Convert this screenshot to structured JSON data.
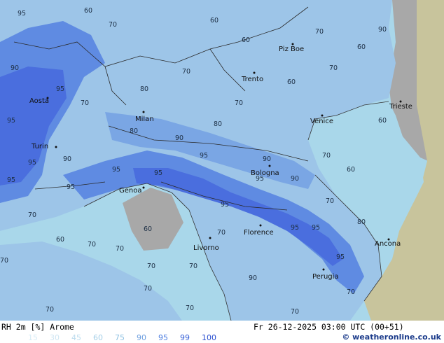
{
  "footer": {
    "variable": "RH 2m [%] Arome",
    "datetime": "Fr 26-12-2025 03:00 UTC (00+51)",
    "credit": "© weatheronline.co.uk"
  },
  "legend": {
    "values": [
      "15",
      "30",
      "45",
      "60",
      "75",
      "90",
      "95",
      "99",
      "100"
    ],
    "colors": [
      "#d8ecf6",
      "#cfe6f3",
      "#bcdcee",
      "#a5cfe8",
      "#8fc1e2",
      "#6e9fe0",
      "#4f7fe0",
      "#3a63d8",
      "#2a4fd0"
    ]
  },
  "colors": {
    "sea": "#a9d7ea",
    "land_gray": "#a8a8a8",
    "land_tan": "#c8c49c",
    "rh70": "#9dc5e8",
    "rh90": "#7aa6e4",
    "rh95": "#5f8be2",
    "rh99": "#4a6ede"
  },
  "cities": [
    {
      "name": "Aosta"
    },
    {
      "name": "Turin"
    },
    {
      "name": "Milan"
    },
    {
      "name": "Genoa"
    },
    {
      "name": "Trento"
    },
    {
      "name": "Piz Boe"
    },
    {
      "name": "Venice"
    },
    {
      "name": "Trieste"
    },
    {
      "name": "Bologna"
    },
    {
      "name": "Florence"
    },
    {
      "name": "Livorno"
    },
    {
      "name": "Ancona"
    },
    {
      "name": "Perugia"
    }
  ],
  "isolines": [
    "95",
    "90",
    "80",
    "70",
    "60",
    "85"
  ]
}
